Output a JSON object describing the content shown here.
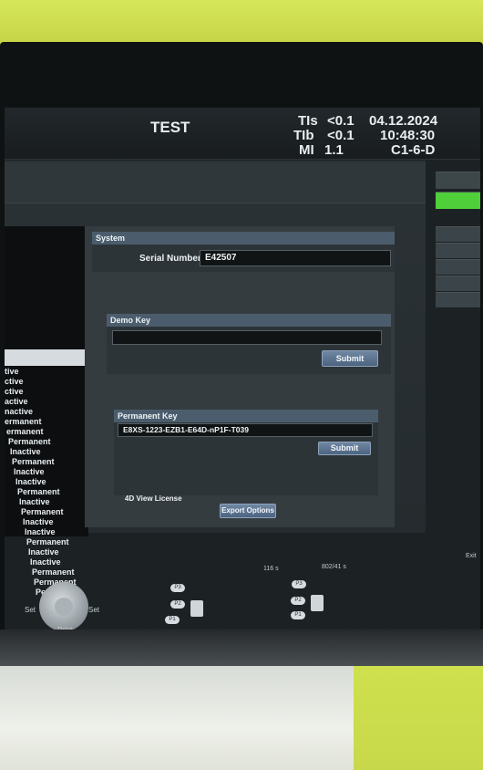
{
  "header": {
    "title": "TEST",
    "tis_label": "TIs",
    "tis_value": "<0.1",
    "tib_label": "TIb",
    "tib_value": "<0.1",
    "mi_label": "MI",
    "mi_value": "1.1",
    "date": "04.12.2024",
    "time": "10:48:30",
    "probe": "C1-6-D"
  },
  "license_list": [
    "tive",
    "ctive",
    "ctive",
    "active",
    "nactive",
    "ermanent",
    "ermanent",
    "Permanent",
    "Inactive",
    "Permanent",
    "Inactive",
    "Inactive",
    "Permanent",
    "Inactive",
    "Permanent",
    "Inactive",
    "Inactive",
    "Permanent",
    "Inactive",
    "Inactive",
    "Permanent",
    "Permanent",
    "Permanent"
  ],
  "system": {
    "section_label": "System",
    "serial_label": "Serial Number",
    "serial_value": "E42507"
  },
  "demo_key": {
    "section_label": "Demo Key",
    "value": "",
    "submit_label": "Submit"
  },
  "permanent_key": {
    "section_label": "Permanent Key",
    "value": "E8XS-1223-EZB1-E64D-nP1F-T039",
    "submit_label": "Submit"
  },
  "view_license": {
    "section_label": "4D View License",
    "export_label": "Export Options"
  },
  "status": {
    "left_readout": "116 s",
    "right_readout": "802/41 s",
    "exit_label": "Exit"
  },
  "controls": {
    "set_left": "Set",
    "set_right": "Set",
    "print_label": "Print",
    "fkeys_left": [
      "P3",
      "P2",
      "P1"
    ],
    "fkeys_right": [
      "P3",
      "P2",
      "P1"
    ]
  },
  "colors": {
    "accent_green": "#4fcf3a",
    "section_blue": "#4b5d6c",
    "button_blue": "#5d7592"
  }
}
